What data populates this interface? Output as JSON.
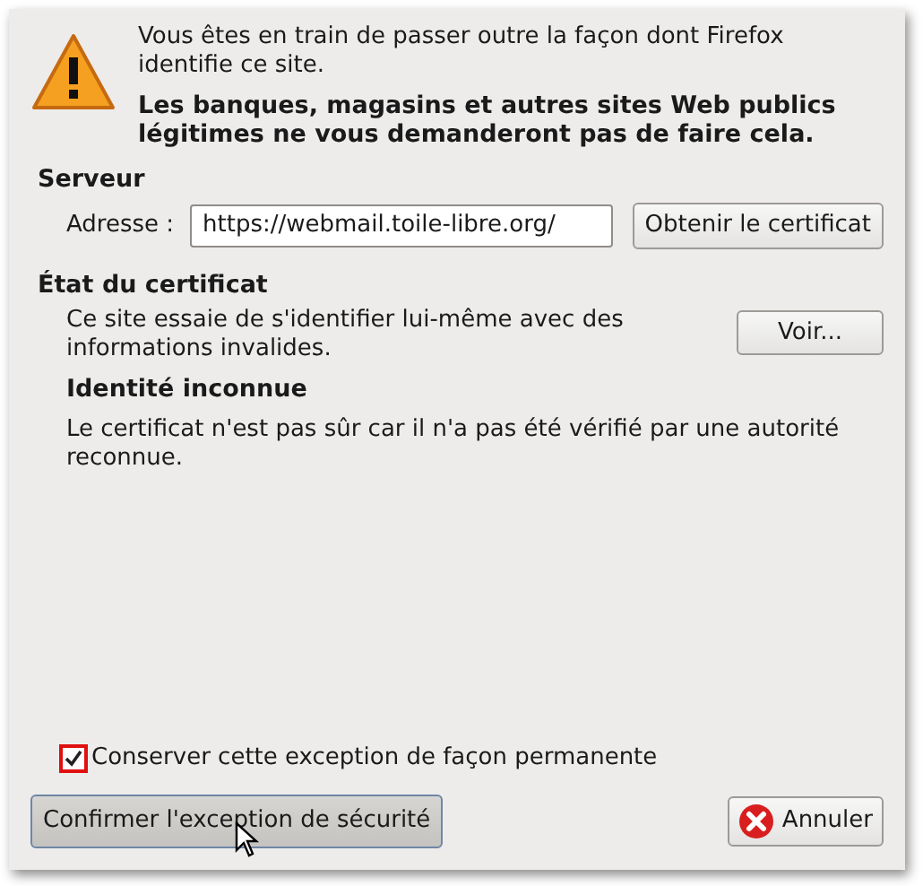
{
  "warning": {
    "message": "Vous êtes en train de passer outre la façon dont Firefox identifie ce site.",
    "emphasis": "Les banques, magasins et autres sites Web publics légitimes ne vous demanderont pas de faire cela."
  },
  "server": {
    "heading": "Serveur",
    "address_label": "Adresse :",
    "address_value": "https://webmail.toile-libre.org/",
    "get_button": "Obtenir le certificat"
  },
  "certificate": {
    "heading": "État du certificat",
    "status_text": "Ce site essaie de s'identifier lui-même avec des informations invalides.",
    "view_button": "Voir...",
    "issue_title": "Identité inconnue",
    "issue_text": "Le certificat n'est pas sûr car il n'a pas été vérifié par une autorité reconnue."
  },
  "permanent": {
    "label": "Conserver cette exception de façon permanente",
    "checked": true
  },
  "buttons": {
    "confirm": "Confirmer l'exception de sécurité",
    "cancel": "Annuler"
  }
}
